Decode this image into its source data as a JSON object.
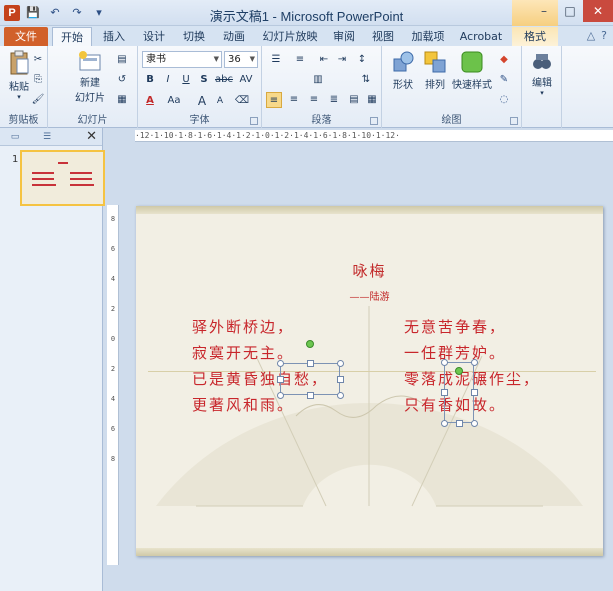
{
  "window": {
    "title": "演示文稿1 - Microsoft PowerPoint",
    "app_icon": "P"
  },
  "qat": {
    "save": "💾",
    "undo": "↶",
    "redo": "↷",
    "customize": "▾"
  },
  "tabs": [
    {
      "label": "文件"
    },
    {
      "label": "开始"
    },
    {
      "label": "插入"
    },
    {
      "label": "设计"
    },
    {
      "label": "切换"
    },
    {
      "label": "动画"
    },
    {
      "label": "幻灯片放映"
    },
    {
      "label": "审阅"
    },
    {
      "label": "视图"
    },
    {
      "label": "加载项"
    },
    {
      "label": "Acrobat"
    },
    {
      "label": "格式"
    }
  ],
  "ribbon": {
    "clipboard": {
      "paste": "粘贴",
      "label": "剪贴板"
    },
    "slides": {
      "new_slide_1": "新建",
      "new_slide_2": "幻灯片",
      "label": "幻灯片"
    },
    "font": {
      "name": "隶书",
      "size": "36",
      "label": "字体",
      "bold": "B",
      "italic": "I",
      "underline": "U",
      "shadow": "S",
      "strike": "abc",
      "spacing": "AV",
      "color": "A",
      "case": "Aa",
      "grow": "A",
      "shrink": "A"
    },
    "paragraph": {
      "label": "段落"
    },
    "drawing": {
      "shape": "形状",
      "arrange": "排列",
      "quick_style": "快速样式",
      "label": "绘图"
    },
    "editing": {
      "label": "编辑"
    }
  },
  "left_panel": {
    "slide_number": "1"
  },
  "slide": {
    "title": "咏梅",
    "author": "——陆游",
    "left_lines": [
      "驿外断桥边，",
      "寂寞开无主。",
      "已是黄昏独自愁，",
      "更著风和雨。"
    ],
    "right_lines": [
      "无意苦争春，",
      "一任群芳妒。",
      "零落成泥碾作尘，",
      "只有香如故。"
    ]
  },
  "colors": {
    "poem_red": "#c8262b",
    "file_tab": "#d1602a"
  }
}
